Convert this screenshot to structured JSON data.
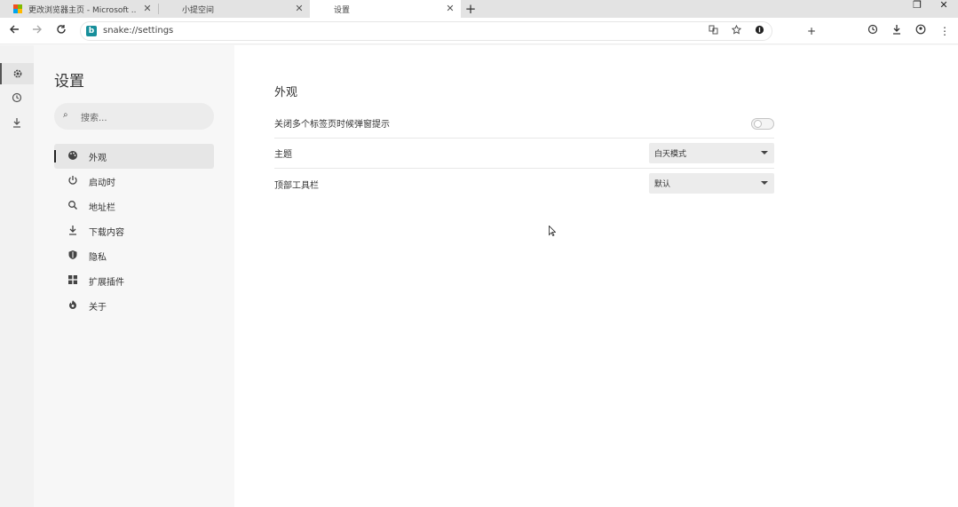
{
  "tabs": [
    {
      "title": "更改浏览器主页 - Microsoft ...",
      "close": "✕"
    },
    {
      "title": "小提空间",
      "close": "✕"
    },
    {
      "title": "设置",
      "close": "✕"
    }
  ],
  "new_tab": "+",
  "window_controls": {
    "restore": "❐",
    "close": "✕"
  },
  "toolbar": {
    "url": "snake://settings",
    "favicon_letter": "b",
    "extra_buttons": {
      "add": "+",
      "history": "⟲",
      "download": "⤓",
      "profile": "☺",
      "menu": "⋮"
    }
  },
  "settings": {
    "title": "设置",
    "search_placeholder": "搜索...",
    "nav": [
      {
        "label": "外观",
        "icon": "palette-icon",
        "glyph": "🎨"
      },
      {
        "label": "启动时",
        "icon": "power-icon",
        "glyph": "⏻"
      },
      {
        "label": "地址栏",
        "icon": "search-icon",
        "glyph": "⌕"
      },
      {
        "label": "下载内容",
        "icon": "download-icon",
        "glyph": "⤓"
      },
      {
        "label": "隐私",
        "icon": "shield-icon",
        "glyph": "⛊"
      },
      {
        "label": "扩展插件",
        "icon": "extensions-icon",
        "glyph": "▦"
      },
      {
        "label": "关于",
        "icon": "about-icon",
        "glyph": "◉"
      }
    ]
  },
  "appearance": {
    "section_title": "外观",
    "rows": [
      {
        "label": "关闭多个标签页时候弹窗提示",
        "type": "toggle",
        "on": false
      },
      {
        "label": "主题",
        "type": "select",
        "value": "白天模式"
      },
      {
        "label": "顶部工具栏",
        "type": "select",
        "value": "默认"
      }
    ]
  },
  "colors": {
    "accent": "#178f9b",
    "rail_bg": "#f2f2f2",
    "sidebar_bg": "#f7f7f7",
    "main_bg": "#ffffff"
  }
}
